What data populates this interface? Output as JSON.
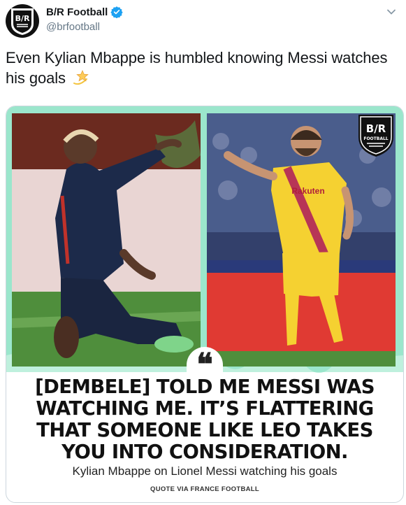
{
  "account": {
    "display_name": "B/R Football",
    "handle": "@brfootball",
    "avatar_text": "B/R",
    "verified_icon": "verified-badge-icon"
  },
  "tweet": {
    "text": "Even Kylian Mbappe is humbled knowing Messi watches his goals",
    "emoji_icon": "dizzy-star-emoji"
  },
  "media": {
    "left_photo": "Kylian Mbappe pointing",
    "right_photo": "Lionel Messi pointing",
    "badge": {
      "line1": "B/R",
      "line2": "FOOTBALL"
    },
    "jersey_sponsor": "Rakuten",
    "quote_mark": "❝",
    "headline_lines": [
      "[DEMBELE] TOLD ME MESSI WAS",
      "WATCHING ME. IT’S FLATTERING",
      "THAT SOMEONE LIKE LEO TAKES",
      "YOU INTO CONSIDERATION."
    ],
    "attribution": "Kylian Mbappe on Lionel Messi watching his goals",
    "credit": "QUOTE VIA FRANCE FOOTBALL"
  },
  "colors": {
    "accent_mint": "#8fe0c6",
    "psg_navy": "#1c2a4a",
    "barca_yellow": "#f5d131",
    "grass": "#4b8a3a"
  }
}
